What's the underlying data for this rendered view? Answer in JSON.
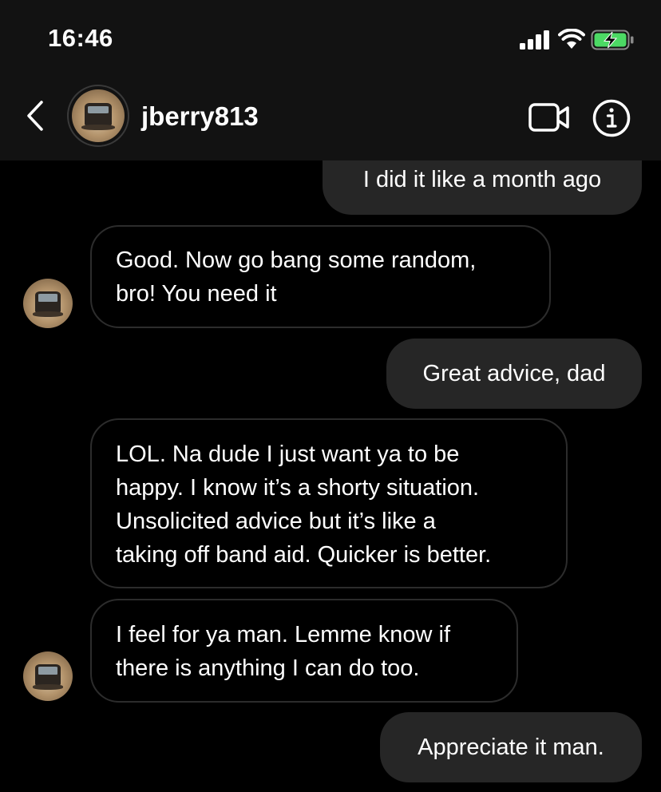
{
  "status_bar": {
    "time": "16:46",
    "battery_color": "#4cd964"
  },
  "header": {
    "username": "jberry813",
    "icons": [
      "back-chevron-icon",
      "video-camera-icon",
      "info-icon"
    ]
  },
  "messages": [
    {
      "direction": "outgoing",
      "text": "I did it like a month ago"
    },
    {
      "direction": "incoming",
      "lines": [
        "Good. Now go bang some random,",
        "bro!  You need it"
      ]
    },
    {
      "direction": "outgoing",
      "text": "Great advice, dad"
    },
    {
      "direction": "incoming",
      "lines": [
        "LOL. Na dude I just want ya to be",
        "happy. I know it’s a shorty situation.",
        "Unsolicited advice but it’s like a",
        "taking off band aid. Quicker is better."
      ]
    },
    {
      "direction": "incoming",
      "lines": [
        "I feel for ya man. Lemme know if",
        "there is anything I can do too."
      ]
    },
    {
      "direction": "outgoing",
      "text": "Appreciate it man."
    }
  ],
  "colors": {
    "background": "#000000",
    "header_background": "#121212",
    "outgoing_bubble": "#262626",
    "incoming_border": "#2c2c2c"
  }
}
